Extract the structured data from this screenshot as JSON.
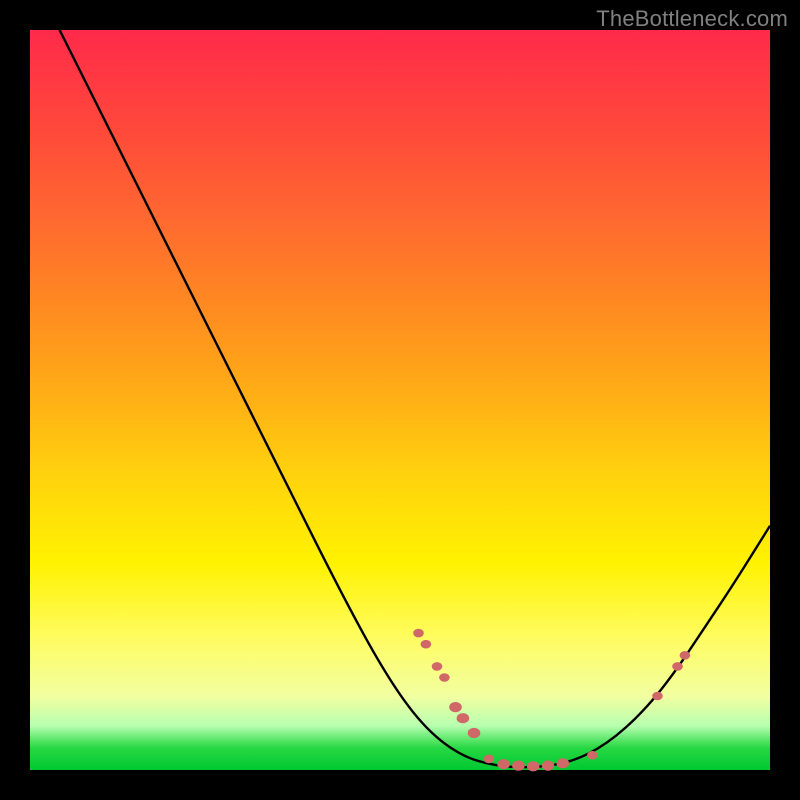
{
  "watermark": "TheBottleneck.com",
  "chart_data": {
    "type": "line",
    "title": "",
    "xlabel": "",
    "ylabel": "",
    "xlim": [
      0,
      100
    ],
    "ylim": [
      0,
      100
    ],
    "grid": false,
    "legend": false,
    "curve_points": [
      {
        "x": 4,
        "y": 100
      },
      {
        "x": 10,
        "y": 88
      },
      {
        "x": 18,
        "y": 72
      },
      {
        "x": 26,
        "y": 56
      },
      {
        "x": 34,
        "y": 40
      },
      {
        "x": 42,
        "y": 24
      },
      {
        "x": 48,
        "y": 13
      },
      {
        "x": 53,
        "y": 6
      },
      {
        "x": 58,
        "y": 2
      },
      {
        "x": 63,
        "y": 0.5
      },
      {
        "x": 68,
        "y": 0.3
      },
      {
        "x": 73,
        "y": 1.0
      },
      {
        "x": 78,
        "y": 3.5
      },
      {
        "x": 83,
        "y": 8
      },
      {
        "x": 87,
        "y": 13
      },
      {
        "x": 91,
        "y": 19
      },
      {
        "x": 95,
        "y": 25
      },
      {
        "x": 100,
        "y": 33
      }
    ],
    "markers": [
      {
        "x": 52.5,
        "y": 18.5,
        "r": 5
      },
      {
        "x": 53.5,
        "y": 17.0,
        "r": 5
      },
      {
        "x": 55.0,
        "y": 14.0,
        "r": 5
      },
      {
        "x": 56.0,
        "y": 12.5,
        "r": 5
      },
      {
        "x": 57.5,
        "y": 8.5,
        "r": 6
      },
      {
        "x": 58.5,
        "y": 7.0,
        "r": 6
      },
      {
        "x": 60.0,
        "y": 5.0,
        "r": 6
      },
      {
        "x": 62.0,
        "y": 1.5,
        "r": 5
      },
      {
        "x": 64.0,
        "y": 0.8,
        "r": 6
      },
      {
        "x": 66.0,
        "y": 0.6,
        "r": 6
      },
      {
        "x": 68.0,
        "y": 0.5,
        "r": 6
      },
      {
        "x": 70.0,
        "y": 0.6,
        "r": 6
      },
      {
        "x": 72.0,
        "y": 0.9,
        "r": 6
      },
      {
        "x": 76.0,
        "y": 2.0,
        "r": 5
      },
      {
        "x": 84.8,
        "y": 10.0,
        "r": 5
      },
      {
        "x": 87.5,
        "y": 14.0,
        "r": 5
      },
      {
        "x": 88.5,
        "y": 15.5,
        "r": 5
      }
    ]
  }
}
